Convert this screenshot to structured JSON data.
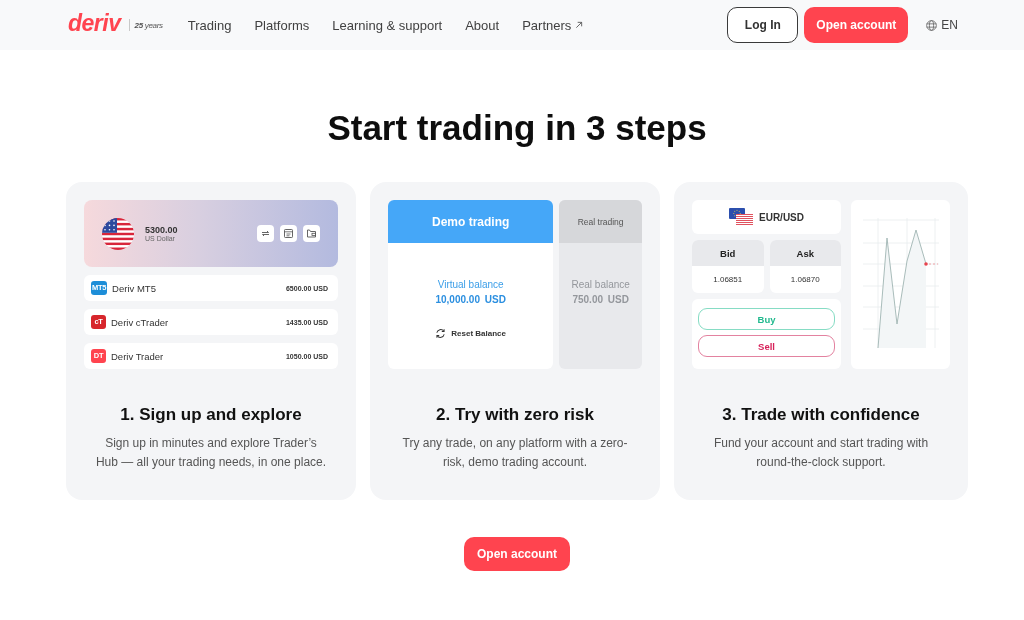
{
  "header": {
    "logo": {
      "wordmark": "deriv",
      "anniversary": "**25** years"
    },
    "nav": [
      {
        "label": "Trading",
        "external": false
      },
      {
        "label": "Platforms",
        "external": false
      },
      {
        "label": "Learning & support",
        "external": false
      },
      {
        "label": "About",
        "external": false
      },
      {
        "label": "Partners",
        "external": true
      }
    ],
    "login": "Log In",
    "signup": "Open account",
    "language": "EN"
  },
  "heading": "Start trading in 3 steps",
  "steps": [
    {
      "kind": "accounts",
      "wallet": {
        "balance": "5300.00",
        "currency": "US Dollar"
      },
      "accounts": [
        {
          "logo": "MT5",
          "name": "Deriv MT5",
          "amount": "6500.00 USD",
          "color": "#1d8ed8"
        },
        {
          "logo": "cT",
          "name": "Deriv cTrader",
          "amount": "1435.00 USD",
          "color": "#d7262c"
        },
        {
          "logo": "DT",
          "name": "Deriv Trader",
          "amount": "1050.00 USD",
          "color": "#ff444f"
        }
      ],
      "title": "1. Sign up and explore",
      "description": "Sign up in minutes and explore Trader’s Hub — all your trading needs, in one place."
    },
    {
      "kind": "demo",
      "panels": [
        {
          "tab": "Demo trading",
          "selected": true,
          "balance_label": "Virtual balance",
          "amount": "10,000.00 USD",
          "action": "Reset Balance"
        },
        {
          "tab": "Real trading",
          "selected": false,
          "balance_label": "Real balance",
          "amount": "750.00 USD"
        }
      ],
      "title": "2. Try with zero risk",
      "description": "Try any trade, on any platform with a zero-risk, demo trading account."
    },
    {
      "kind": "trade",
      "pair": "EUR/USD",
      "quotes": [
        {
          "label": "Bid",
          "value": "1.06851"
        },
        {
          "label": "Ask",
          "value": "1.06870"
        }
      ],
      "actions": [
        {
          "label": "Buy",
          "kind": "buy"
        },
        {
          "label": "Sell",
          "kind": "sell"
        }
      ],
      "title": "3. Trade with confidence",
      "description": "Fund your account and start trading with round-the-clock support."
    }
  ],
  "cta": "Open account"
}
